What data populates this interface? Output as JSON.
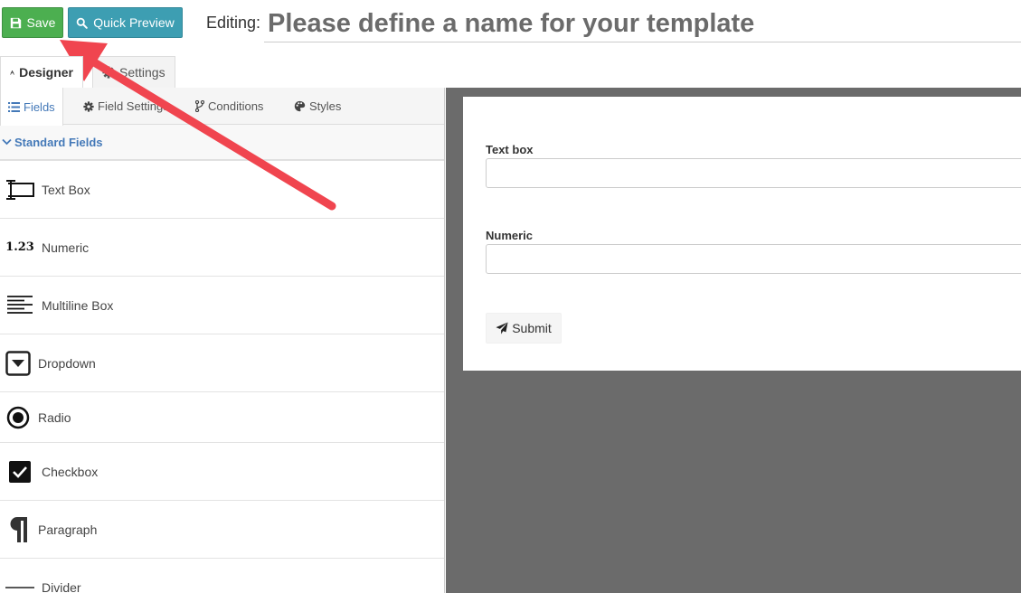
{
  "toolbar": {
    "save_label": "Save",
    "preview_label": "Quick Preview",
    "editing_label": "Editing:",
    "template_name_placeholder": "Please define a name for your template"
  },
  "main_tabs": {
    "designer": "Designer",
    "settings": "Settings"
  },
  "sub_tabs": {
    "fields": "Fields",
    "field_settings": "Field Settings",
    "conditions": "Conditions",
    "styles": "Styles"
  },
  "section": {
    "title": "Standard Fields"
  },
  "fields": [
    {
      "label": "Text Box",
      "icon": "textbox-icon"
    },
    {
      "label": "Numeric",
      "icon": "numeric-icon"
    },
    {
      "label": "Multiline Box",
      "icon": "multiline-icon"
    },
    {
      "label": "Dropdown",
      "icon": "dropdown-icon"
    },
    {
      "label": "Radio",
      "icon": "radio-icon"
    },
    {
      "label": "Checkbox",
      "icon": "checkbox-icon"
    },
    {
      "label": "Paragraph",
      "icon": "paragraph-icon"
    },
    {
      "label": "Divider",
      "icon": "divider-icon"
    }
  ],
  "numeric_icon_text": "1.23",
  "form": {
    "textbox_label": "Text box",
    "numeric_label": "Numeric",
    "submit_label": "Submit"
  },
  "colors": {
    "save_green": "#4caf50",
    "preview_teal": "#3d9eb2",
    "accent_blue": "#4479b8",
    "canvas_gray": "#6b6b6b",
    "annotation_red": "#f0454f"
  }
}
